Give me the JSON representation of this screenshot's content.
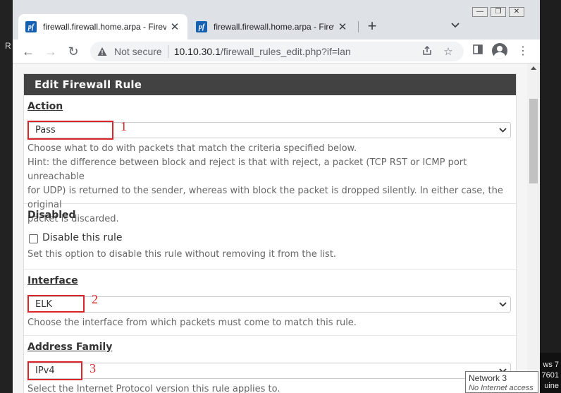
{
  "desktop": {
    "left_text": "R",
    "right_lines": [
      "ws 7",
      "7601",
      "uine"
    ]
  },
  "browser": {
    "tabs": [
      {
        "favicon": "pf",
        "title": "firewall.firewall.home.arpa - Firev",
        "active": true
      },
      {
        "favicon": "pf",
        "title": "firewall.firewall.home.arpa - Firev",
        "active": false
      }
    ],
    "new_tab_symbol": "+",
    "tab_search_symbol": "⌄",
    "window_controls": [
      "—",
      "❐",
      "✕"
    ],
    "nav": {
      "back": "←",
      "forward": "→",
      "reload": "↻"
    },
    "security_text": "Not secure",
    "url_host": "10.10.30.1",
    "url_path": "/firewall_rules_edit.php?if=lan",
    "icons": [
      "share-icon",
      "star-icon",
      "sidepanel-icon",
      "avatar-icon",
      "menu-icon"
    ]
  },
  "form": {
    "heading": "Edit Firewall Rule",
    "action": {
      "label": "Action",
      "value": "Pass",
      "annotation": "1",
      "help_lines": [
        "Choose what to do with packets that match the criteria specified below.",
        "Hint: the difference between block and reject is that with reject, a packet (TCP RST or ICMP port unreachable",
        "for UDP) is returned to the sender, whereas with block the packet is dropped silently. In either case, the original",
        "packet is discarded."
      ]
    },
    "disabled": {
      "label": "Disabled",
      "checkbox_label": "Disable this rule",
      "checked": false,
      "help": "Set this option to disable this rule without removing it from the list."
    },
    "interface": {
      "label": "Interface",
      "value": "ELK",
      "annotation": "2",
      "help": "Choose the interface from which packets must come to match this rule."
    },
    "address_family": {
      "label": "Address Family",
      "value": "IPv4",
      "annotation": "3",
      "help": "Select the Internet Protocol version this rule applies to."
    }
  },
  "tooltip": {
    "title": "Network  3",
    "subtitle": "No Internet access"
  },
  "colors": {
    "annotation_red": "#d9262c",
    "heading_bg": "#424242",
    "tab_bg": "#dee1e6"
  }
}
